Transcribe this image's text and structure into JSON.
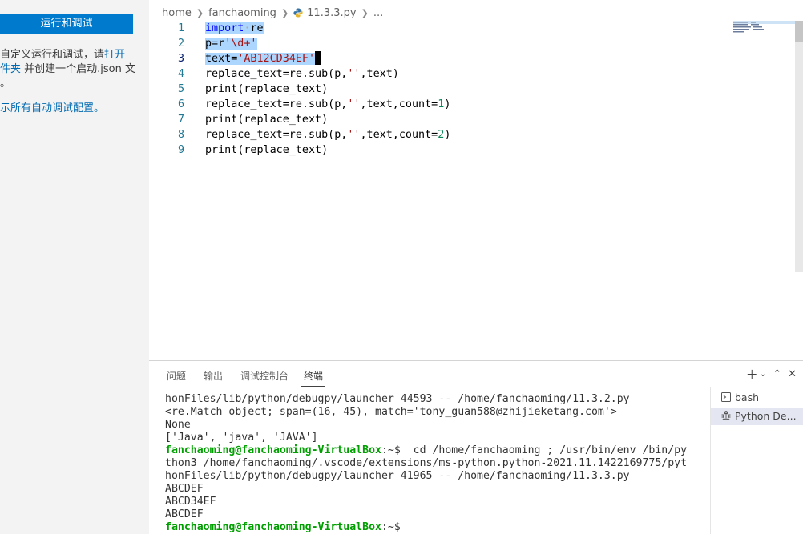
{
  "sidebar": {
    "run_button": "运行和调试",
    "p1_text": "自定义运行和调试，请",
    "p1_link": "打开",
    "p2_link": "件夹",
    "p2_text": " 并创建一个启动.json 文",
    "p3_text": "。",
    "p4_link": "示所有自动调试配置。"
  },
  "breadcrumb": {
    "items": [
      "home",
      "fanchaoming",
      "11.3.3.py",
      "..."
    ]
  },
  "editor": {
    "line_numbers": [
      "1",
      "2",
      "3",
      "4",
      "5",
      "6",
      "7",
      "8",
      "9"
    ],
    "lines": [
      {
        "parts": [
          {
            "t": "import",
            "c": "kw"
          },
          {
            "t": "·",
            "c": "ws"
          },
          {
            "t": "re",
            "c": ""
          }
        ]
      },
      {
        "parts": [
          {
            "t": "p=r",
            "c": ""
          },
          {
            "t": "'\\d+'",
            "c": "str"
          }
        ]
      },
      {
        "parts": [
          {
            "t": "text=",
            "c": ""
          },
          {
            "t": "'AB12CD34EF'",
            "c": "str"
          }
        ]
      },
      {
        "parts": [
          {
            "t": "replace_text=re.sub(p,",
            "c": ""
          },
          {
            "t": "''",
            "c": "str"
          },
          {
            "t": ",text)",
            "c": ""
          }
        ]
      },
      {
        "parts": [
          {
            "t": "print(replace_text)",
            "c": ""
          }
        ]
      },
      {
        "parts": [
          {
            "t": "replace_text=re.sub(p,",
            "c": ""
          },
          {
            "t": "''",
            "c": "str"
          },
          {
            "t": ",text,count=",
            "c": ""
          },
          {
            "t": "1",
            "c": "num"
          },
          {
            "t": ")",
            "c": ""
          }
        ]
      },
      {
        "parts": [
          {
            "t": "print(replace_text)",
            "c": ""
          }
        ]
      },
      {
        "parts": [
          {
            "t": "replace_text=re.sub(p,",
            "c": ""
          },
          {
            "t": "''",
            "c": "str"
          },
          {
            "t": ",text,count=",
            "c": ""
          },
          {
            "t": "2",
            "c": "num"
          },
          {
            "t": ")",
            "c": ""
          }
        ]
      },
      {
        "parts": [
          {
            "t": "print(replace_text)",
            "c": ""
          }
        ]
      }
    ]
  },
  "panel": {
    "tabs": [
      "问题",
      "输出",
      "调试控制台",
      "终端"
    ],
    "active_tab": "终端"
  },
  "terminal": {
    "lines": [
      {
        "user": "",
        "text": "honFiles/lib/python/debugpy/launcher 44593 -- /home/fanchaoming/11.3.2.py"
      },
      {
        "user": "",
        "text": "<re.Match object; span=(16, 45), match='tony_guan588@zhijieketang.com'>"
      },
      {
        "user": "",
        "text": "None"
      },
      {
        "user": "",
        "text": "['Java', 'java', 'JAVA']"
      },
      {
        "user": "fanchaoming@fanchaoming-VirtualBox",
        "text": ":~$  cd /home/fanchaoming ; /usr/bin/env /bin/py"
      },
      {
        "user": "",
        "text": "thon3 /home/fanchaoming/.vscode/extensions/ms-python.python-2021.11.1422169775/pyt"
      },
      {
        "user": "",
        "text": "honFiles/lib/python/debugpy/launcher 41965 -- /home/fanchaoming/11.3.3.py"
      },
      {
        "user": "",
        "text": "ABCDEF"
      },
      {
        "user": "",
        "text": "ABCD34EF"
      },
      {
        "user": "",
        "text": "ABCDEF"
      },
      {
        "user": "fanchaoming@fanchaoming-VirtualBox",
        "text": ":~$"
      }
    ],
    "instances": [
      {
        "label": "bash",
        "icon": "terminal-icon"
      },
      {
        "label": "Python De...",
        "icon": "debug-icon"
      }
    ]
  },
  "colors": {
    "accent": "#007acc",
    "prompt_user": "#00a000",
    "selection": "#add6ff"
  }
}
